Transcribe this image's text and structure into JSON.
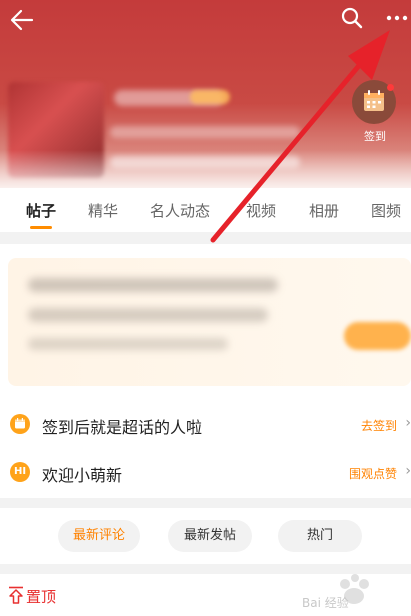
{
  "header": {
    "signin_label": "签到"
  },
  "tabs": [
    {
      "label": "帖子",
      "active": true
    },
    {
      "label": "精华"
    },
    {
      "label": "名人动态"
    },
    {
      "label": "视频"
    },
    {
      "label": "相册"
    },
    {
      "label": "图频"
    }
  ],
  "rows": [
    {
      "title": "签到后就是超话的人啦",
      "action": "去签到",
      "icon": "calendar-icon"
    },
    {
      "title": "欢迎小萌新",
      "action": "围观点赞",
      "icon": "hi-icon",
      "icon_text": "HI"
    }
  ],
  "sort": [
    "最新评论",
    "最新发帖",
    "热门"
  ],
  "pinned": {
    "label": "置顶"
  },
  "colors": {
    "accent": "#ff8200",
    "header_red": "#c43b3b",
    "pin_red": "#e83030",
    "annotation_arrow": "#e6222a"
  },
  "watermark": {
    "text": "Bai 经验"
  }
}
